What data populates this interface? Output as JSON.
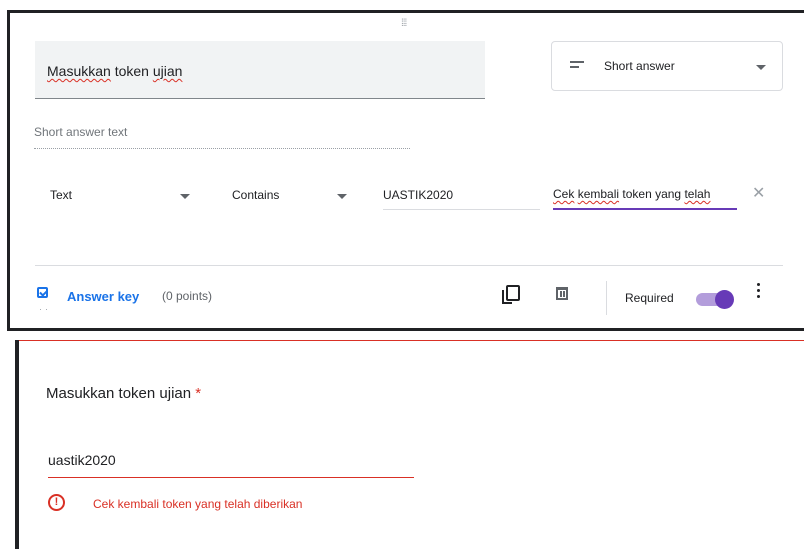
{
  "editor": {
    "question_title": "Masukkan token ujian",
    "question_type": "Short answer",
    "answer_placeholder": "Short answer text",
    "validation": {
      "type": "Text",
      "condition": "Contains",
      "value": "UASTIK2020",
      "error_text": "Cek kembali token yang telah"
    },
    "footer": {
      "answer_key": "Answer key",
      "points": "(0 points)",
      "required": "Required",
      "required_on": true
    }
  },
  "preview": {
    "title": "Masukkan token ujian",
    "required_marker": "*",
    "answer_value": "uastik2020",
    "error_message": "Cek kembali token yang telah diberikan"
  },
  "colors": {
    "accent": "#673ab7",
    "link": "#1a73e8",
    "error": "#d93025"
  }
}
